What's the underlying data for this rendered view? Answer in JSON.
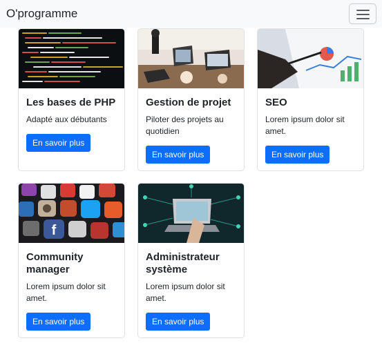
{
  "navbar": {
    "brand": "O'programme",
    "toggler_icon": "hamburger-icon"
  },
  "courses": [
    {
      "title": "Les bases de PHP",
      "text": "Adapté aux débutants",
      "button": "En savoir plus",
      "image": "php-code-image"
    },
    {
      "title": "Gestion de projet",
      "text": "Piloter des projets au quotidien",
      "button": "En savoir plus",
      "image": "meeting-laptops-image"
    },
    {
      "title": "SEO",
      "text": "Lorem ipsum dolor sit amet.",
      "button": "En savoir plus",
      "image": "analytics-tablet-image"
    },
    {
      "title": "Community manager",
      "text": "Lorem ipsum dolor sit amet.",
      "button": "En savoir plus",
      "image": "social-apps-image"
    },
    {
      "title": "Administrateur système",
      "text": "Lorem ipsum dolor sit amet.",
      "button": "En savoir plus",
      "image": "network-laptop-image"
    }
  ],
  "colors": {
    "primary": "#0d6efd",
    "navbar_bg": "#f8f9fa"
  }
}
